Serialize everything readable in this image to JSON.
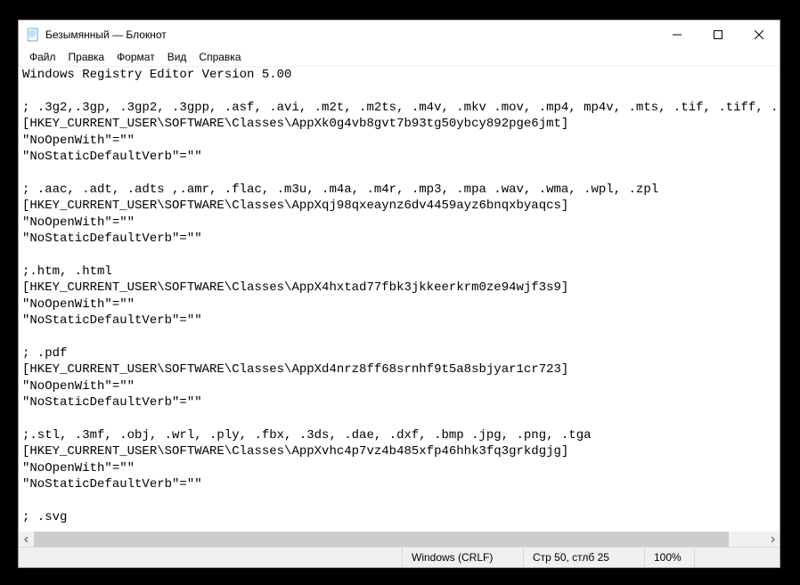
{
  "window": {
    "title": "Безымянный — Блокнот"
  },
  "menu": {
    "file": "Файл",
    "edit": "Правка",
    "format": "Формат",
    "view": "Вид",
    "help": "Справка"
  },
  "content": "Windows Registry Editor Version 5.00\n\n; .3g2,.3gp, .3gp2, .3gpp, .asf, .avi, .m2t, .m2ts, .m4v, .mkv .mov, .mp4, mp4v, .mts, .tif, .tiff, .\n[HKEY_CURRENT_USER\\SOFTWARE\\Classes\\AppXk0g4vb8gvt7b93tg50ybcy892pge6jmt]\n\"NoOpenWith\"=\"\"\n\"NoStaticDefaultVerb\"=\"\"\n\n; .aac, .adt, .adts ,.amr, .flac, .m3u, .m4a, .m4r, .mp3, .mpa .wav, .wma, .wpl, .zpl\n[HKEY_CURRENT_USER\\SOFTWARE\\Classes\\AppXqj98qxeaynz6dv4459ayz6bnqxbyaqcs]\n\"NoOpenWith\"=\"\"\n\"NoStaticDefaultVerb\"=\"\"\n\n;.htm, .html\n[HKEY_CURRENT_USER\\SOFTWARE\\Classes\\AppX4hxtad77fbk3jkkeerkrm0ze94wjf3s9]\n\"NoOpenWith\"=\"\"\n\"NoStaticDefaultVerb\"=\"\"\n\n; .pdf\n[HKEY_CURRENT_USER\\SOFTWARE\\Classes\\AppXd4nrz8ff68srnhf9t5a8sbjyar1cr723]\n\"NoOpenWith\"=\"\"\n\"NoStaticDefaultVerb\"=\"\"\n\n;.stl, .3mf, .obj, .wrl, .ply, .fbx, .3ds, .dae, .dxf, .bmp .jpg, .png, .tga\n[HKEY_CURRENT_USER\\SOFTWARE\\Classes\\AppXvhc4p7vz4b485xfp46hhk3fq3grkdgjg]\n\"NoOpenWith\"=\"\"\n\"NoStaticDefaultVerb\"=\"\"\n\n; .svg",
  "statusbar": {
    "line_ending": "Windows (CRLF)",
    "cursor": "Стр 50, стлб 25",
    "zoom": "100%"
  }
}
